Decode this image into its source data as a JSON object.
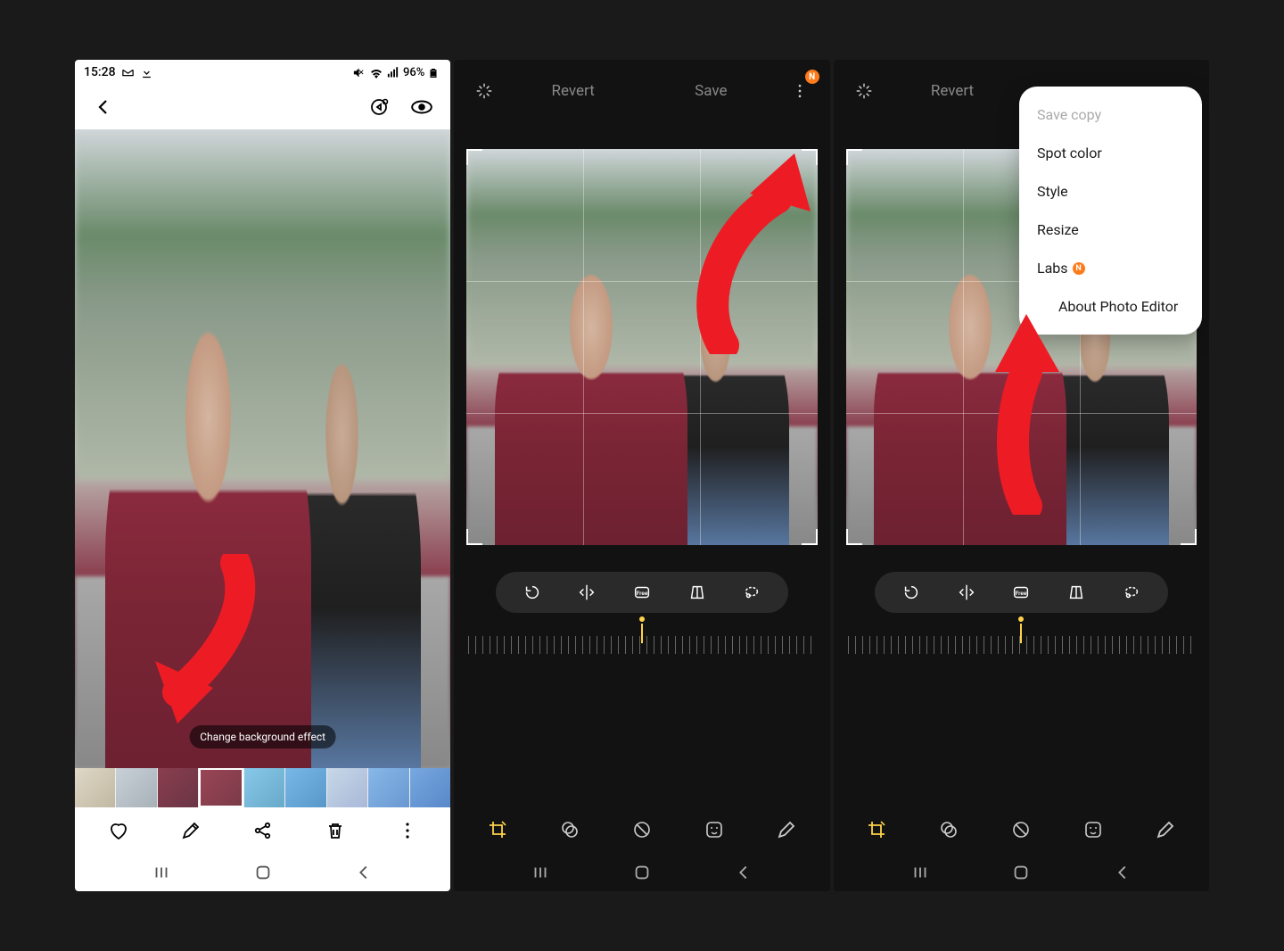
{
  "status": {
    "time": "15:28",
    "battery": "96%"
  },
  "gallery": {
    "tooltip": "Change background effect"
  },
  "editor": {
    "revert": "Revert",
    "save": "Save",
    "n_badge": "N",
    "crop_tools": {
      "free": "Free"
    }
  },
  "menu": {
    "save_copy": "Save copy",
    "spot_color": "Spot color",
    "style": "Style",
    "resize": "Resize",
    "labs": "Labs",
    "labs_badge": "N",
    "about": "About Photo Editor"
  }
}
